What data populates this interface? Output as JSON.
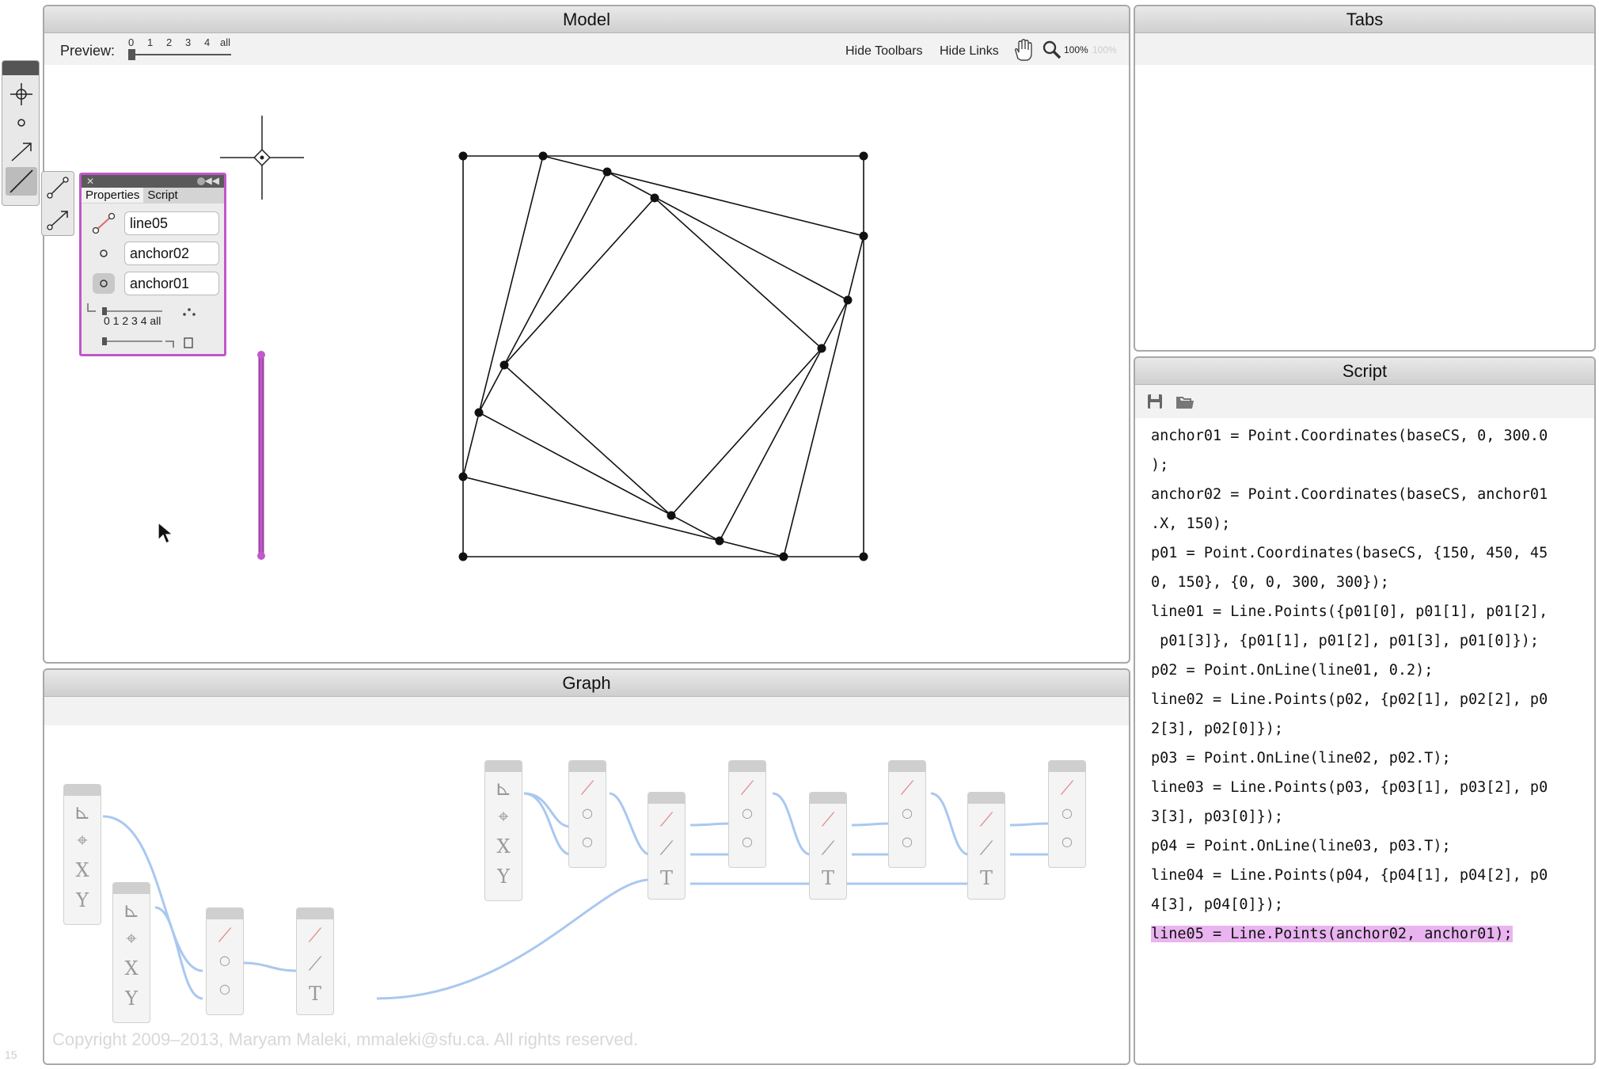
{
  "model": {
    "title": "Model",
    "preview_label": "Preview:",
    "preview_ticks": [
      "0",
      "1",
      "2",
      "3",
      "4",
      "all"
    ],
    "hide_toolbars": "Hide Toolbars",
    "hide_links": "Hide Links",
    "zoom": "100%",
    "zoom_disabled": "100%"
  },
  "properties": {
    "tabs": [
      "Properties",
      "Script"
    ],
    "rows": [
      "line05",
      "anchor02",
      "anchor01"
    ],
    "slider_labels": "0 1 2 3 4 all"
  },
  "tabs_panel": {
    "title": "Tabs"
  },
  "script": {
    "title": "Script",
    "lines": [
      "anchor01 = Point.Coordinates(baseCS, 0, 300.0",
      ");",
      "anchor02 = Point.Coordinates(baseCS, anchor01",
      ".X, 150);",
      "p01 = Point.Coordinates(baseCS, {150, 450, 45",
      "0, 150}, {0, 0, 300, 300});",
      "line01 = Line.Points({p01[0], p01[1], p01[2],",
      " p01[3]}, {p01[1], p01[2], p01[3], p01[0]});",
      "p02 = Point.OnLine(line01, 0.2);",
      "line02 = Line.Points(p02, {p02[1], p02[2], p0",
      "2[3], p02[0]});",
      "p03 = Point.OnLine(line02, p02.T);",
      "line03 = Line.Points(p03, {p03[1], p03[2], p0",
      "3[3], p03[0]});",
      "p04 = Point.OnLine(line03, p03.T);",
      "line04 = Line.Points(p04, {p04[1], p04[2], p0",
      "4[3], p04[0]});"
    ],
    "highlighted_line": "line05 = Line.Points(anchor02, anchor01);"
  },
  "graph": {
    "title": "Graph",
    "copyright": "Copyright 2009–2013, Maryam Maleki, mmaleki@sfu.ca.   All rights reserved.",
    "glyph_x": "X",
    "glyph_y": "Y",
    "glyph_t": "T"
  },
  "corner_number": "15",
  "colors": {
    "selection": "#c157c9",
    "link": "#a9c8f0",
    "highlight": "#e9b4f0"
  }
}
